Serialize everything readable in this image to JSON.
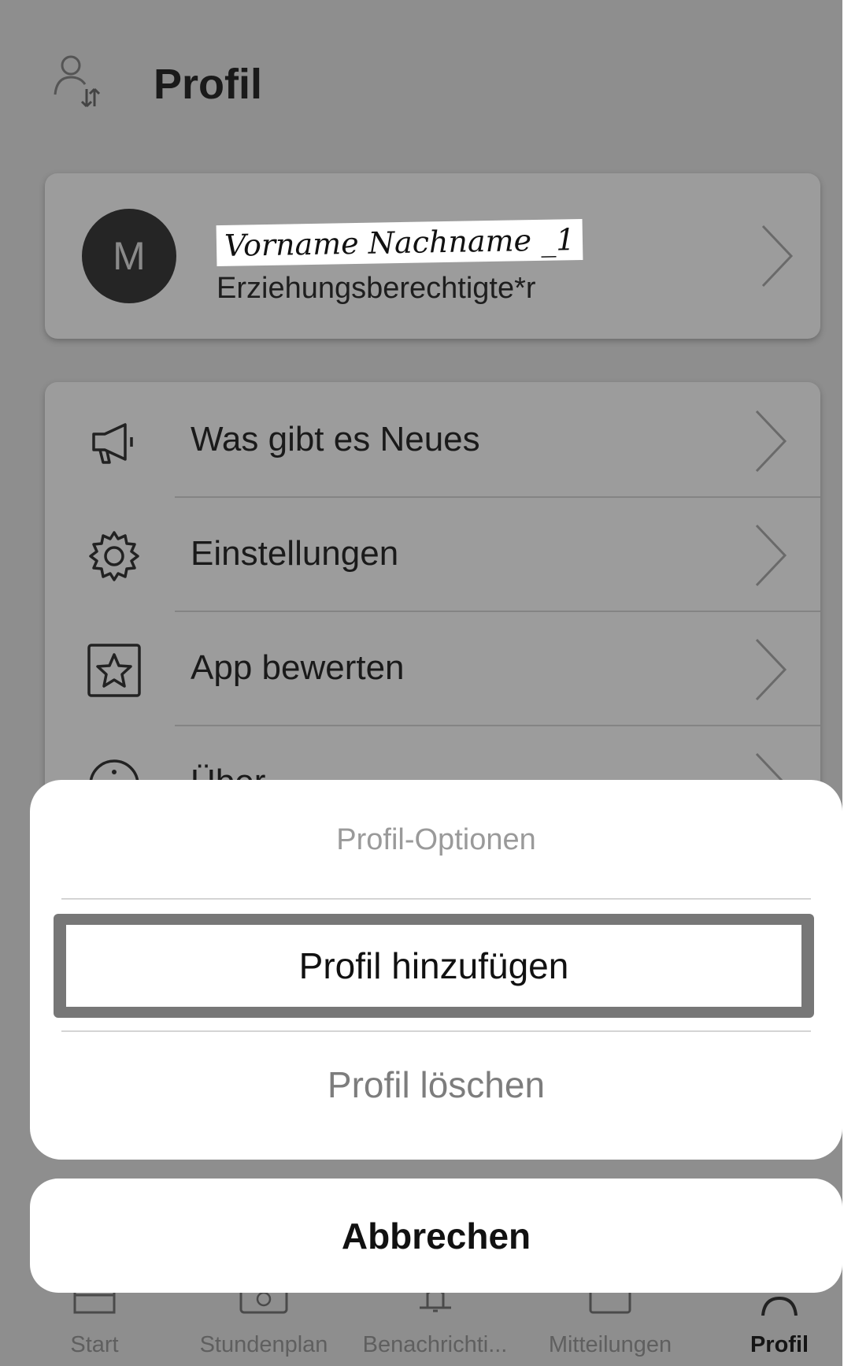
{
  "header": {
    "title": "Profil",
    "switch_icon": "profile-switch-icon"
  },
  "profile": {
    "avatar_initial": "M",
    "name": "Vorname Nachname _1",
    "role": "Erziehungsberechtigte*r"
  },
  "menu": {
    "items": [
      {
        "label": "Was gibt es Neues",
        "icon": "megaphone-icon"
      },
      {
        "label": "Einstellungen",
        "icon": "gear-icon"
      },
      {
        "label": "App bewerten",
        "icon": "star-icon"
      },
      {
        "label": "Über",
        "icon": "info-icon"
      }
    ]
  },
  "sheet": {
    "title": "Profil-Optionen",
    "add_label": "Profil hinzufügen",
    "delete_label": "Profil löschen",
    "cancel_label": "Abbrechen"
  },
  "tabbar": {
    "tabs": [
      {
        "label": "Start",
        "icon": "calendar-icon",
        "active": false
      },
      {
        "label": "Stundenplan",
        "icon": "schedule-icon",
        "active": false
      },
      {
        "label": "Benachrichti...",
        "icon": "bell-icon",
        "active": false
      },
      {
        "label": "Mitteilungen",
        "icon": "messages-icon",
        "active": false
      },
      {
        "label": "Profil",
        "icon": "profile-icon",
        "active": true
      }
    ]
  },
  "colors": {
    "overlay": "#8e8e8e",
    "sheet_bg": "#ffffff",
    "text": "#1a1a1a"
  }
}
